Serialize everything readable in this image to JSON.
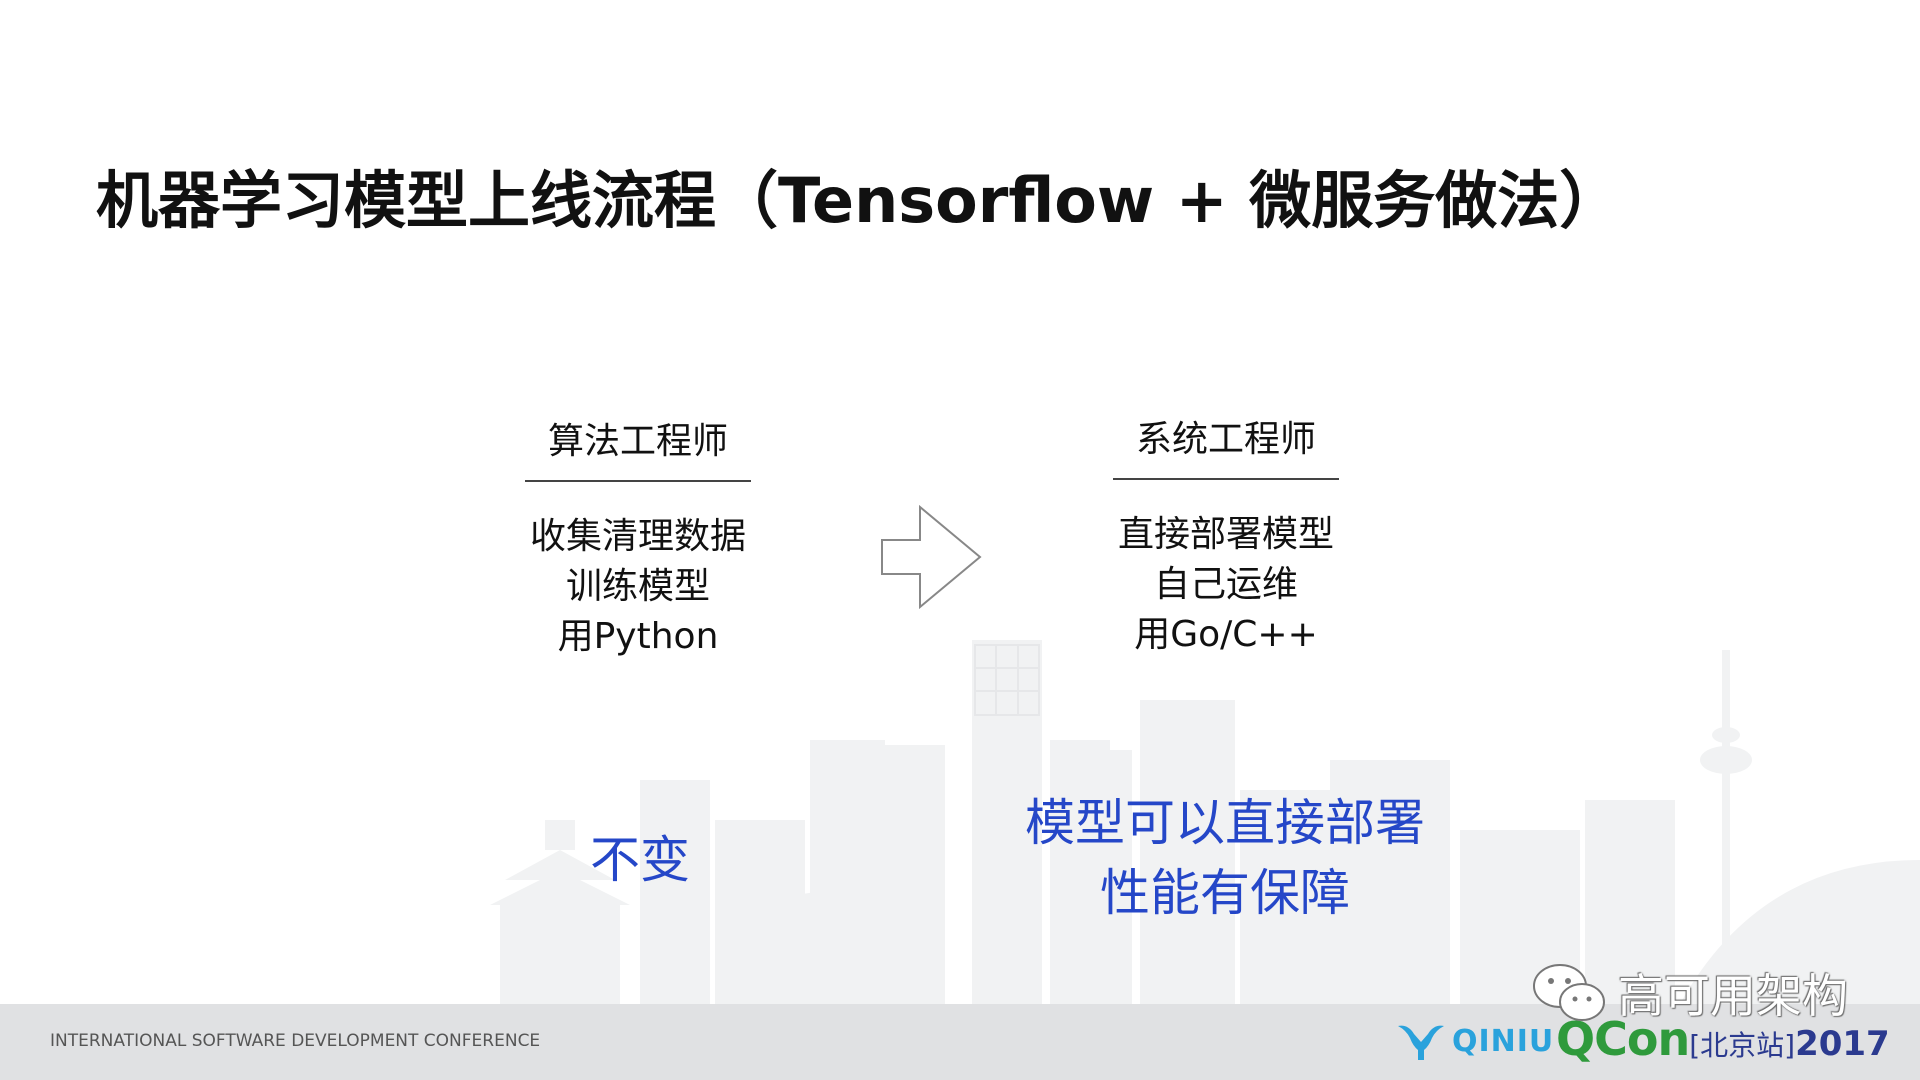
{
  "slide": {
    "title": "机器学习模型上线流程（Tensorflow + 微服务做法）"
  },
  "left_column": {
    "header": "算法工程师",
    "lines": [
      "收集清理数据",
      "训练模型",
      "用Python"
    ]
  },
  "right_column": {
    "header": "系统工程师",
    "lines": [
      "直接部署模型",
      "自己运维",
      "用Go/C++"
    ]
  },
  "left_highlight": {
    "text": "不变"
  },
  "right_highlight": {
    "lines": [
      "模型可以直接部署",
      "性能有保障"
    ]
  },
  "footer": {
    "conference_name": "INTERNATIONAL SOFTWARE DEVELOPMENT CONFERENCE",
    "sponsor": "QINIU",
    "brand": "QCon",
    "site": "[北京站]",
    "year": "2017"
  },
  "watermark": {
    "text": "高可用架构"
  },
  "icons": {
    "arrow": "right-arrow-outline-icon",
    "wechat": "wechat-icon",
    "qiniu": "qiniu-logo-icon"
  },
  "colors": {
    "highlight_blue": "#2547c8",
    "footer_bar": "#e0e1e3",
    "qcon_green": "#2f9a3c",
    "qcon_blue": "#2b3a8f",
    "qiniu_blue": "#2aa2dc"
  }
}
